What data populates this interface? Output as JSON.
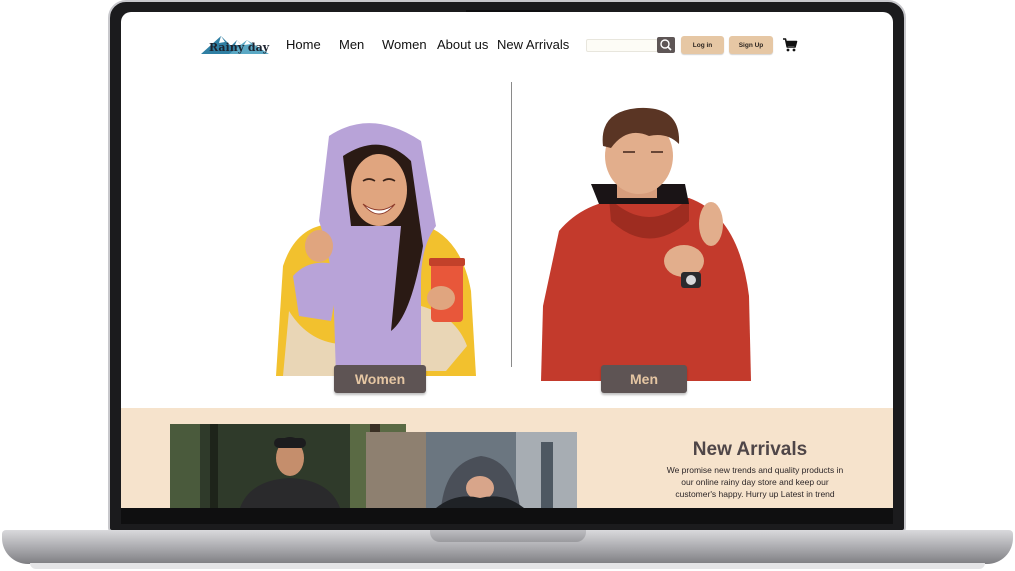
{
  "header": {
    "logo_text": "Rainy day",
    "nav": [
      "Home",
      "Men",
      "Women",
      "About us",
      "New Arrivals"
    ],
    "search": {
      "placeholder": ""
    },
    "login_label": "Log in",
    "signup_label": "Sign Up"
  },
  "hero": {
    "women_label": "Women",
    "men_label": "Men"
  },
  "arrivals": {
    "title": "New Arrivals",
    "text": "We promise new trends and quality products in our online rainy day store and keep our customer's happy. Hurry up Latest in trend"
  },
  "colors": {
    "accent_tan": "#e6c7a4",
    "button_dark": "#5e5454",
    "band_background": "#f6e3cc",
    "jacket_yellow": "#f2c12e",
    "jacket_red": "#c33a2c"
  },
  "icons": [
    "mountain-logo",
    "search-icon",
    "cart-icon"
  ]
}
